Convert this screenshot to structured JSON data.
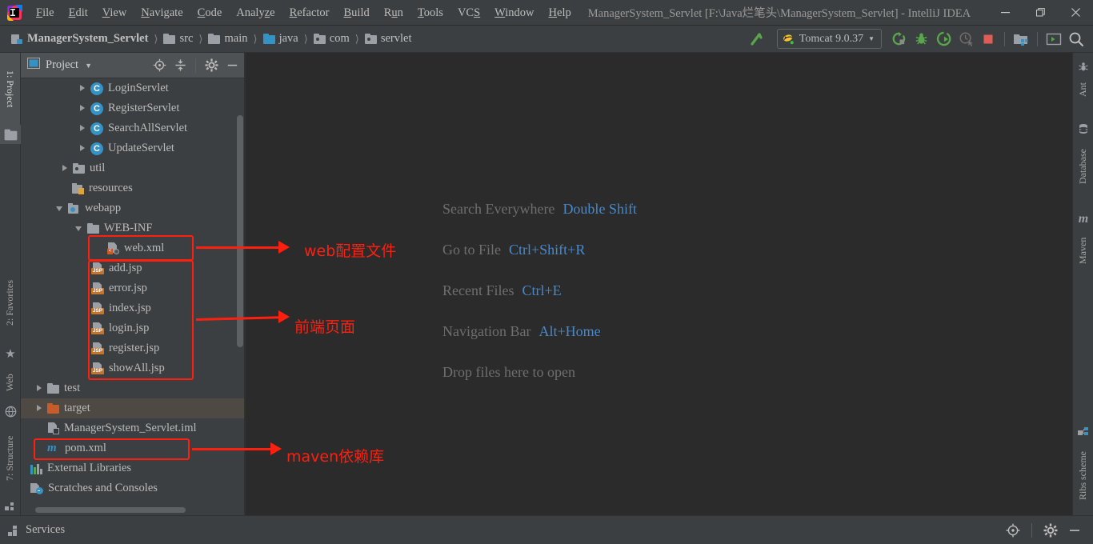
{
  "window": {
    "title": "ManagerSystem_Servlet [F:\\Java烂笔头\\ManagerSystem_Servlet] - IntelliJ IDEA",
    "minimize": "—",
    "maximize": "❐",
    "close": "✕"
  },
  "menu": {
    "items": [
      {
        "label": "File",
        "mnemonic": "F"
      },
      {
        "label": "Edit",
        "mnemonic": "E"
      },
      {
        "label": "View",
        "mnemonic": "V"
      },
      {
        "label": "Navigate",
        "mnemonic": "N"
      },
      {
        "label": "Code",
        "mnemonic": "C"
      },
      {
        "label": "Analyze",
        "mnemonic": "z"
      },
      {
        "label": "Refactor",
        "mnemonic": "R"
      },
      {
        "label": "Build",
        "mnemonic": "B"
      },
      {
        "label": "Run",
        "mnemonic": "u"
      },
      {
        "label": "Tools",
        "mnemonic": "T"
      },
      {
        "label": "VCS",
        "mnemonic": "S"
      },
      {
        "label": "Window",
        "mnemonic": "W"
      },
      {
        "label": "Help",
        "mnemonic": "H"
      }
    ]
  },
  "breadcrumbs": [
    {
      "label": "ManagerSystem_Servlet",
      "icon": "module-icon"
    },
    {
      "label": "src",
      "icon": "folder-icon"
    },
    {
      "label": "main",
      "icon": "folder-icon"
    },
    {
      "label": "java",
      "icon": "source-folder-icon"
    },
    {
      "label": "com",
      "icon": "package-icon"
    },
    {
      "label": "servlet",
      "icon": "package-icon"
    }
  ],
  "toolbar": {
    "build_label": "Build",
    "run_config": "Tomcat 9.0.37",
    "run_label": "Run",
    "debug_label": "Debug",
    "run_coverage_label": "Run with Coverage",
    "profile_label": "Profile",
    "stop_label": "Stop",
    "project_structure_label": "Project Structure",
    "terminal_label": "Terminal",
    "search_label": "Search Everywhere"
  },
  "left_stripe": [
    {
      "label": "1: Project",
      "icon": "project-icon",
      "selected": true
    },
    {
      "label": "2: Favorites",
      "icon": "star-icon",
      "selected": false
    },
    {
      "label": "Web",
      "icon": "web-globe-icon",
      "selected": false
    },
    {
      "label": "7: Structure",
      "icon": "structure-icon",
      "selected": false
    }
  ],
  "right_stripe": [
    {
      "label": "Ant",
      "icon": "ant-icon"
    },
    {
      "label": "Database",
      "icon": "database-icon"
    },
    {
      "label": "Maven",
      "icon": "maven-icon"
    },
    {
      "label": "Ribs scheme",
      "icon": "ribs-scheme-icon"
    }
  ],
  "project_panel": {
    "title": "Project",
    "actions": [
      {
        "name": "locate-icon",
        "label": "Select Opened File"
      },
      {
        "name": "collapse-all-icon",
        "label": "Collapse All"
      },
      {
        "name": "gear-icon",
        "label": "Settings"
      },
      {
        "name": "minimize-icon",
        "label": "Hide"
      }
    ],
    "tree": [
      {
        "label": "LoginServlet",
        "icon": "java-class-icon",
        "indent": 5,
        "arrow": "right",
        "selected": false
      },
      {
        "label": "RegisterServlet",
        "icon": "java-class-icon",
        "indent": 5,
        "arrow": "right",
        "selected": false
      },
      {
        "label": "SearchAllServlet",
        "icon": "java-class-icon",
        "indent": 5,
        "arrow": "right",
        "selected": false
      },
      {
        "label": "UpdateServlet",
        "icon": "java-class-icon",
        "indent": 5,
        "arrow": "right",
        "selected": false
      },
      {
        "label": "util",
        "icon": "package-icon",
        "indent": 4,
        "arrow": "right",
        "selected": false
      },
      {
        "label": "resources",
        "icon": "resources-icon",
        "indent": 3,
        "arrow": "none",
        "selected": false
      },
      {
        "label": "webapp",
        "icon": "webapp-icon",
        "indent": 3,
        "arrow": "down",
        "selected": false
      },
      {
        "label": "WEB-INF",
        "icon": "folder-icon",
        "indent": 4,
        "arrow": "down",
        "selected": false
      },
      {
        "label": "web.xml",
        "icon": "web-xml-icon",
        "indent": 5,
        "arrow": "none",
        "selected": false
      },
      {
        "label": "add.jsp",
        "icon": "jsp-icon",
        "indent": 4,
        "arrow": "none",
        "selected": false
      },
      {
        "label": "error.jsp",
        "icon": "jsp-icon",
        "indent": 4,
        "arrow": "none",
        "selected": false
      },
      {
        "label": "index.jsp",
        "icon": "jsp-icon",
        "indent": 4,
        "arrow": "none",
        "selected": false
      },
      {
        "label": "login.jsp",
        "icon": "jsp-icon",
        "indent": 4,
        "arrow": "none",
        "selected": false
      },
      {
        "label": "register.jsp",
        "icon": "jsp-icon",
        "indent": 4,
        "arrow": "none",
        "selected": false
      },
      {
        "label": "showAll.jsp",
        "icon": "jsp-icon",
        "indent": 4,
        "arrow": "none",
        "selected": false
      },
      {
        "label": "test",
        "icon": "folder-icon",
        "indent": 2,
        "arrow": "right",
        "selected": false
      },
      {
        "label": "target",
        "icon": "target-folder-icon",
        "indent": 2,
        "arrow": "right",
        "selected": true
      },
      {
        "label": "ManagerSystem_Servlet.iml",
        "icon": "iml-file-icon",
        "indent": 2,
        "arrow": "none",
        "selected": false
      },
      {
        "label": "pom.xml",
        "icon": "maven-pom-icon",
        "indent": 2,
        "arrow": "none",
        "selected": false
      },
      {
        "label": "External Libraries",
        "icon": "libraries-icon",
        "indent": 1,
        "arrow": "none",
        "selected": false
      },
      {
        "label": "Scratches and Consoles",
        "icon": "scratches-icon",
        "indent": 1,
        "arrow": "none",
        "selected": false
      }
    ]
  },
  "editor_hints": [
    {
      "action": "Search Everywhere",
      "key": "Double Shift"
    },
    {
      "action": "Go to File",
      "key": "Ctrl+Shift+R"
    },
    {
      "action": "Recent Files",
      "key": "Ctrl+E"
    },
    {
      "action": "Navigation Bar",
      "key": "Alt+Home"
    },
    {
      "action": "Drop files here to open",
      "key": ""
    }
  ],
  "annotations": [
    {
      "text": "web配置文件",
      "color": "#ff1f0f"
    },
    {
      "text": "前端页面",
      "color": "#ff1f0f"
    },
    {
      "text": "maven依赖库",
      "color": "#ff1f0f"
    }
  ],
  "statusbar": {
    "services_label": "Services",
    "actions": [
      {
        "name": "locate-icon",
        "label": "Locate"
      },
      {
        "name": "gear-icon",
        "label": "Settings"
      },
      {
        "name": "minimize-icon",
        "label": "Hide"
      }
    ]
  }
}
